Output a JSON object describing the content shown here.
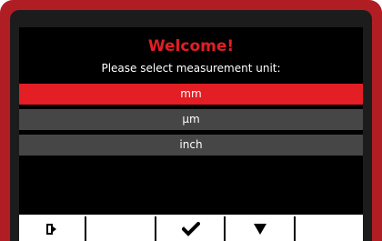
{
  "screen": {
    "title": "Welcome!",
    "subtitle": "Please select measurement unit:"
  },
  "units": {
    "options": [
      "mm",
      "µm",
      "inch"
    ],
    "selected": "mm"
  },
  "softkeys": [
    {
      "icon": "exit-icon"
    },
    {
      "icon": ""
    },
    {
      "icon": "checkmark-icon"
    },
    {
      "icon": "arrow-down-icon"
    },
    {
      "icon": ""
    }
  ],
  "colors": {
    "accent": "#e31e24",
    "frame": "#b01e24",
    "option_bg": "#464646",
    "screen_bg": "#000000"
  }
}
